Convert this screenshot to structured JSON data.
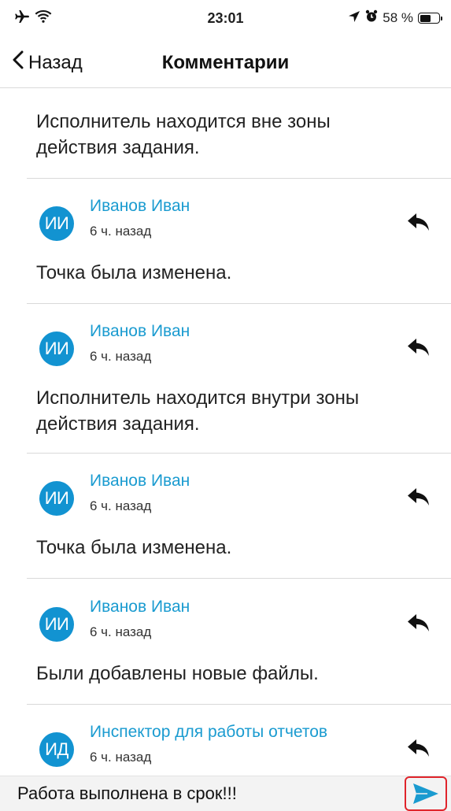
{
  "status_bar": {
    "time": "23:01",
    "battery_pct": "58 %",
    "battery_level": 0.58,
    "icons": [
      "airplane-icon",
      "wifi-icon",
      "location-arrow-icon",
      "alarm-icon",
      "battery-icon"
    ]
  },
  "nav": {
    "back_label": "Назад",
    "title": "Комментарии"
  },
  "comments": {
    "first_text": "Исполнитель находится вне зоны действия задания.",
    "items": [
      {
        "initials": "ИИ",
        "author": "Иванов Иван",
        "time": "6 ч. назад",
        "text": "Точка была изменена."
      },
      {
        "initials": "ИИ",
        "author": "Иванов Иван",
        "time": "6 ч. назад",
        "text": "Исполнитель находится внутри зоны действия задания."
      },
      {
        "initials": "ИИ",
        "author": "Иванов Иван",
        "time": "6 ч. назад",
        "text": "Точка была изменена."
      },
      {
        "initials": "ИИ",
        "author": "Иванов Иван",
        "time": "6 ч. назад",
        "text": "Были добавлены новые файлы."
      },
      {
        "initials": "ИД",
        "author": "Инспектор для работы отчетов",
        "time": "6 ч. назад",
        "text": ""
      }
    ]
  },
  "composer": {
    "value": "Работа выполнена в срок!!!"
  },
  "colors": {
    "accent": "#1a9bd0",
    "avatar": "#1293d1",
    "highlight": "#e0242b"
  }
}
